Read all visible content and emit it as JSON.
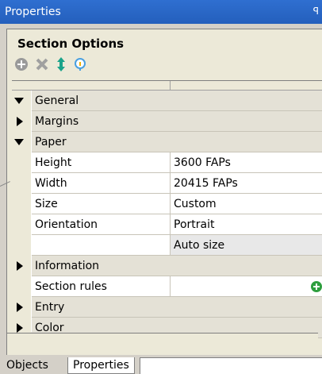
{
  "window": {
    "title": "Properties",
    "pin_glyph": "ꟼ"
  },
  "panel": {
    "section_title": "Section Options"
  },
  "toolbar": {
    "buttons": [
      {
        "name": "add-icon",
        "color": "#9a9a9a"
      },
      {
        "name": "delete-icon",
        "color": "#a0a0a0"
      },
      {
        "name": "move-updown-icon",
        "color": "#1aa38a"
      },
      {
        "name": "info-icon",
        "color": "#4aa0e0"
      }
    ]
  },
  "grid": {
    "rows": [
      {
        "type": "category",
        "expanded": true,
        "name": "General"
      },
      {
        "type": "category",
        "expanded": false,
        "name": "Margins",
        "indent": true
      },
      {
        "type": "category",
        "expanded": true,
        "name": "Paper",
        "indent": true
      },
      {
        "type": "prop",
        "name": "Height",
        "value": "3600 FAPs"
      },
      {
        "type": "prop",
        "name": "Width",
        "value": "20415 FAPs"
      },
      {
        "type": "prop",
        "name": "Size",
        "value": "Custom"
      },
      {
        "type": "prop",
        "name": "Orientation",
        "value": "Portrait"
      },
      {
        "type": "prop",
        "name": "",
        "value": "Auto size",
        "selected": true
      },
      {
        "type": "category",
        "expanded": false,
        "name": "Information"
      },
      {
        "type": "prop",
        "name": "Section rules",
        "value": "",
        "has_add": true
      },
      {
        "type": "category",
        "expanded": false,
        "name": "Entry"
      },
      {
        "type": "category",
        "expanded": false,
        "name": "Color"
      }
    ]
  },
  "tabs": [
    {
      "label": "Objects",
      "active": false
    },
    {
      "label": "Properties",
      "active": true
    }
  ]
}
